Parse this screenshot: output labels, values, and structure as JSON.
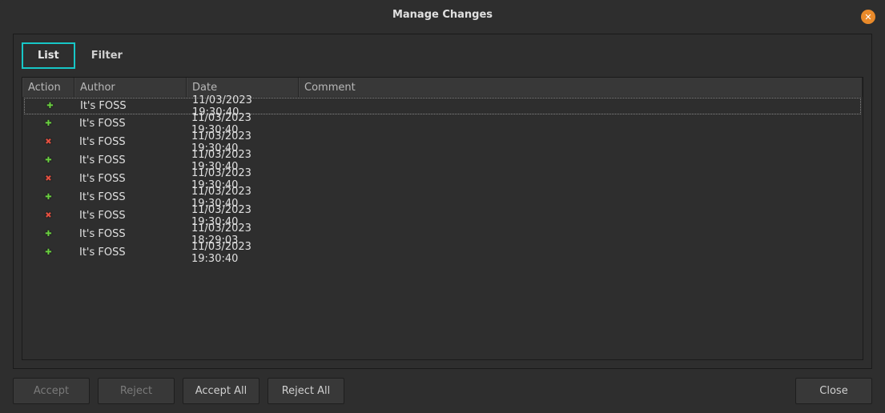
{
  "window": {
    "title": "Manage Changes"
  },
  "tabs": {
    "list": "List",
    "filter": "Filter"
  },
  "table": {
    "headers": {
      "action": "Action",
      "author": "Author",
      "date": "Date",
      "comment": "Comment"
    },
    "rows": [
      {
        "action": "add",
        "author": "It's FOSS",
        "date": "11/03/2023 19:30:40",
        "comment": ""
      },
      {
        "action": "add",
        "author": "It's FOSS",
        "date": "11/03/2023 19:30:40",
        "comment": ""
      },
      {
        "action": "delete",
        "author": "It's FOSS",
        "date": "11/03/2023 19:30:40",
        "comment": ""
      },
      {
        "action": "add",
        "author": "It's FOSS",
        "date": "11/03/2023 19:30:40",
        "comment": ""
      },
      {
        "action": "delete",
        "author": "It's FOSS",
        "date": "11/03/2023 19:30:40",
        "comment": ""
      },
      {
        "action": "add",
        "author": "It's FOSS",
        "date": "11/03/2023 19:30:40",
        "comment": ""
      },
      {
        "action": "delete",
        "author": "It's FOSS",
        "date": "11/03/2023 19:30:40",
        "comment": ""
      },
      {
        "action": "add",
        "author": "It's FOSS",
        "date": "11/03/2023 18:29:03",
        "comment": ""
      },
      {
        "action": "add",
        "author": "It's FOSS",
        "date": "11/03/2023 19:30:40",
        "comment": ""
      }
    ]
  },
  "buttons": {
    "accept": "Accept",
    "reject": "Reject",
    "accept_all": "Accept All",
    "reject_all": "Reject All",
    "close": "Close"
  },
  "icons": {
    "add": "✚",
    "delete": "✖"
  }
}
